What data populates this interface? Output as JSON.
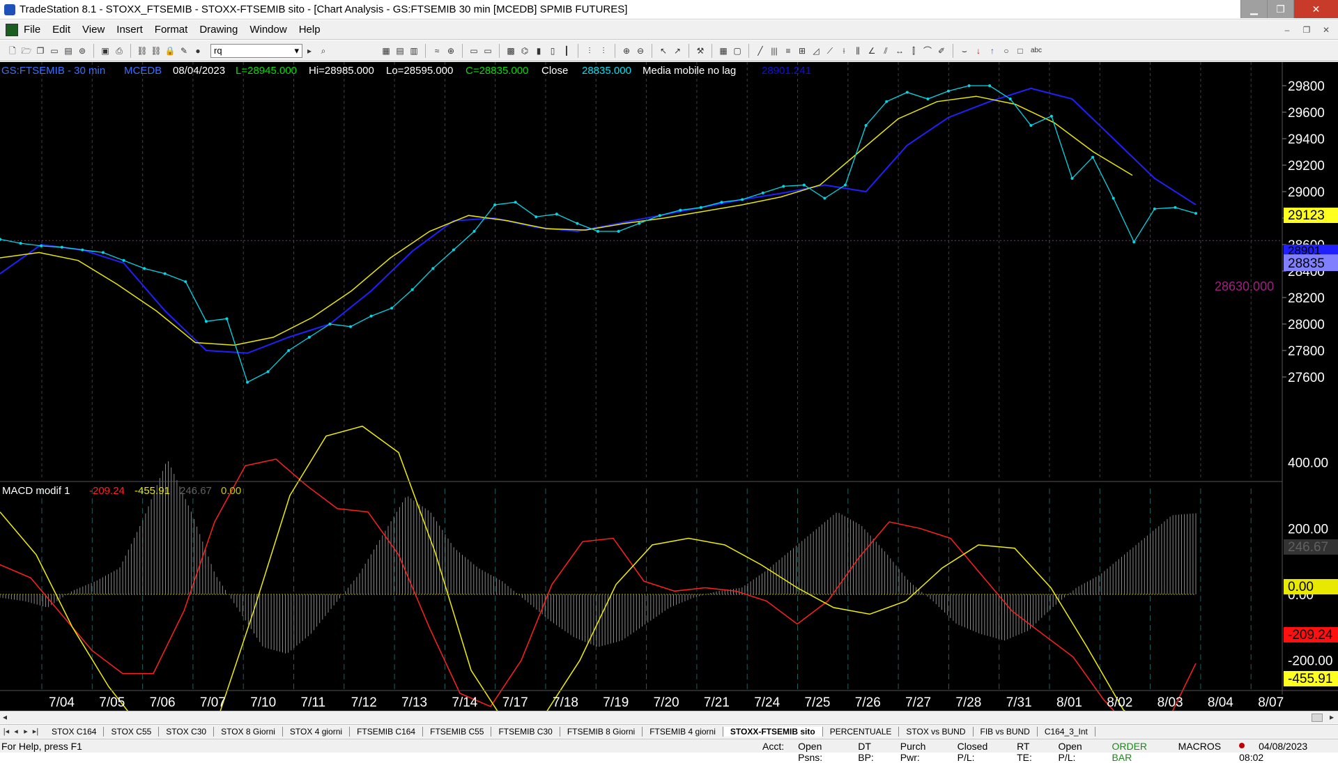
{
  "window": {
    "title": "TradeStation 8.1 - STOXX_FTSEMIB - STOXX-FTSEMIB sito - [Chart Analysis - GS:FTSEMIB  30 min  [MCEDB] SPMIB FUTURES]"
  },
  "window_buttons": {
    "minimize": "▁",
    "maximize": "❐",
    "close": "✕"
  },
  "mdi_buttons": {
    "minimize": "–",
    "restore": "❐",
    "close": "✕"
  },
  "menu": [
    "File",
    "Edit",
    "View",
    "Insert",
    "Format",
    "Drawing",
    "Window",
    "Help"
  ],
  "toolbar": {
    "symbol_value": "rq",
    "dropdown_glyph": "▾",
    "go_glyph": "▸"
  },
  "chart_header": {
    "symbol": "GS:FTSEMIB - 30 min",
    "exchange": "MCEDB",
    "date": "08/04/2023",
    "last": "L=28945.000",
    "high": "Hi=28985.000",
    "low": "Lo=28595.000",
    "close_eq": "C=28835.000",
    "close_label": "Close",
    "close_value": "28835.000",
    "ma_label": "Media mobile no lag",
    "ma_value": "28901.241"
  },
  "macd_header": {
    "name": "MACD modif 1",
    "v1": "-209.24",
    "v2": "-455.91",
    "v3": "246.67",
    "v4": "0.00"
  },
  "price_axis": [
    "29800",
    "29600",
    "29400",
    "29200",
    "29000",
    "28800",
    "28600",
    "28400",
    "28200",
    "28000",
    "27800",
    "27600"
  ],
  "price_tags": {
    "yellow": "29123",
    "blue": "28901",
    "last": "28835"
  },
  "support_line": "28630.000",
  "macd_axis": [
    "400.00",
    "200.00",
    "0.00",
    "-200.00",
    "-400.00"
  ],
  "macd_tags": {
    "hist": "246.67",
    "zero": "0.00",
    "red": "-209.24",
    "yellow": "-455.91"
  },
  "date_axis": [
    "7/04",
    "7/05",
    "7/06",
    "7/07",
    "7/10",
    "7/11",
    "7/12",
    "7/13",
    "7/14",
    "7/17",
    "7/18",
    "7/19",
    "7/20",
    "7/21",
    "7/24",
    "7/25",
    "7/26",
    "7/27",
    "7/28",
    "7/31",
    "8/01",
    "8/02",
    "8/03",
    "8/04",
    "8/07"
  ],
  "chart_data": {
    "type": "line",
    "price_series": {
      "name": "GS:FTSEMIB",
      "color": "#00d8e8",
      "points": [
        28640,
        28610,
        28590,
        28580,
        28560,
        28540,
        28480,
        28420,
        28380,
        28320,
        28020,
        28040,
        27560,
        27640,
        27800,
        27900,
        28000,
        27980,
        28060,
        28120,
        28260,
        28420,
        28560,
        28700,
        28900,
        28920,
        28810,
        28830,
        28760,
        28700,
        28700,
        28760,
        28820,
        28860,
        28880,
        28920,
        28940,
        28990,
        29040,
        29050,
        28950,
        29050,
        29500,
        29680,
        29750,
        29700,
        29760,
        29800,
        29800,
        29700,
        29500,
        29570,
        29100,
        29260,
        28950,
        28620,
        28870,
        28880,
        28835
      ]
    },
    "ma_yellow": {
      "color": "#e8e800",
      "points": [
        28500,
        28540,
        28480,
        28300,
        28100,
        27860,
        27840,
        27900,
        28050,
        28250,
        28500,
        28700,
        28820,
        28780,
        28720,
        28710,
        28760,
        28800,
        28850,
        28900,
        28960,
        29050,
        29300,
        29550,
        29680,
        29720,
        29660,
        29520,
        29300,
        29123
      ]
    },
    "ma_blue": {
      "color": "#2020ff",
      "points": [
        28380,
        28600,
        28560,
        28460,
        28100,
        27800,
        27780,
        27900,
        28000,
        28250,
        28550,
        28780,
        28800,
        28730,
        28700,
        28760,
        28820,
        28880,
        28940,
        28990,
        29050,
        29000,
        29350,
        29560,
        29680,
        29780,
        29700,
        29400,
        29100,
        28901
      ]
    },
    "macd": {
      "x_range": [
        0,
        100
      ],
      "histogram": [
        -10,
        -20,
        -40,
        10,
        40,
        80,
        230,
        410,
        250,
        60,
        -50,
        -160,
        -180,
        -120,
        -30,
        60,
        180,
        300,
        250,
        140,
        80,
        40,
        -20,
        -80,
        -130,
        -160,
        -140,
        -90,
        -40,
        -10,
        10,
        20,
        70,
        130,
        190,
        250,
        210,
        130,
        40,
        -20,
        -90,
        -120,
        -140,
        -110,
        -40,
        20,
        60,
        120,
        180,
        240,
        246
      ],
      "signal_red": [
        90,
        50,
        -60,
        -170,
        -240,
        -240,
        -50,
        220,
        390,
        410,
        330,
        260,
        250,
        120,
        -100,
        -300,
        -340,
        -200,
        30,
        160,
        170,
        40,
        10,
        20,
        10,
        -20,
        -90,
        -20,
        110,
        220,
        200,
        170,
        60,
        -50,
        -120,
        -190,
        -320,
        -420,
        -400,
        -209
      ],
      "signal_yellow": [
        250,
        120,
        -100,
        -280,
        -420,
        -470,
        -380,
        -50,
        300,
        480,
        510,
        430,
        130,
        -230,
        -400,
        -370,
        -200,
        30,
        150,
        170,
        150,
        90,
        20,
        -40,
        -60,
        -20,
        80,
        150,
        140,
        20,
        -160,
        -350,
        -430,
        -455
      ]
    }
  },
  "tabs": [
    "STOX C164",
    "STOX C55",
    "STOX C30",
    "STOX 8 Giorni",
    "STOX 4 giorni",
    "FTSEMIB C164",
    "FTSEMIB C55",
    "FTSEMIB C30",
    "FTSEMIB 8 Giorni",
    "FTSEMIB 4 giorni",
    "STOXX-FTSEMIB sito",
    "PERCENTUALE",
    "STOX vs BUND",
    "FIB vs BUND",
    "C164_3_Int"
  ],
  "active_tab": "STOXX-FTSEMIB sito",
  "status": {
    "help": "For Help, press F1",
    "acct": "Acct:",
    "open_psns": "Open Psns:",
    "dt_bp": "DT BP:",
    "purch_pwr": "Purch Pwr:",
    "closed_pl": "Closed P/L:",
    "rt_te": "RT TE:",
    "open_pl": "Open P/L:",
    "order_bar": "ORDER BAR",
    "macros": "MACROS",
    "datetime": "04/08/2023 08:02"
  }
}
